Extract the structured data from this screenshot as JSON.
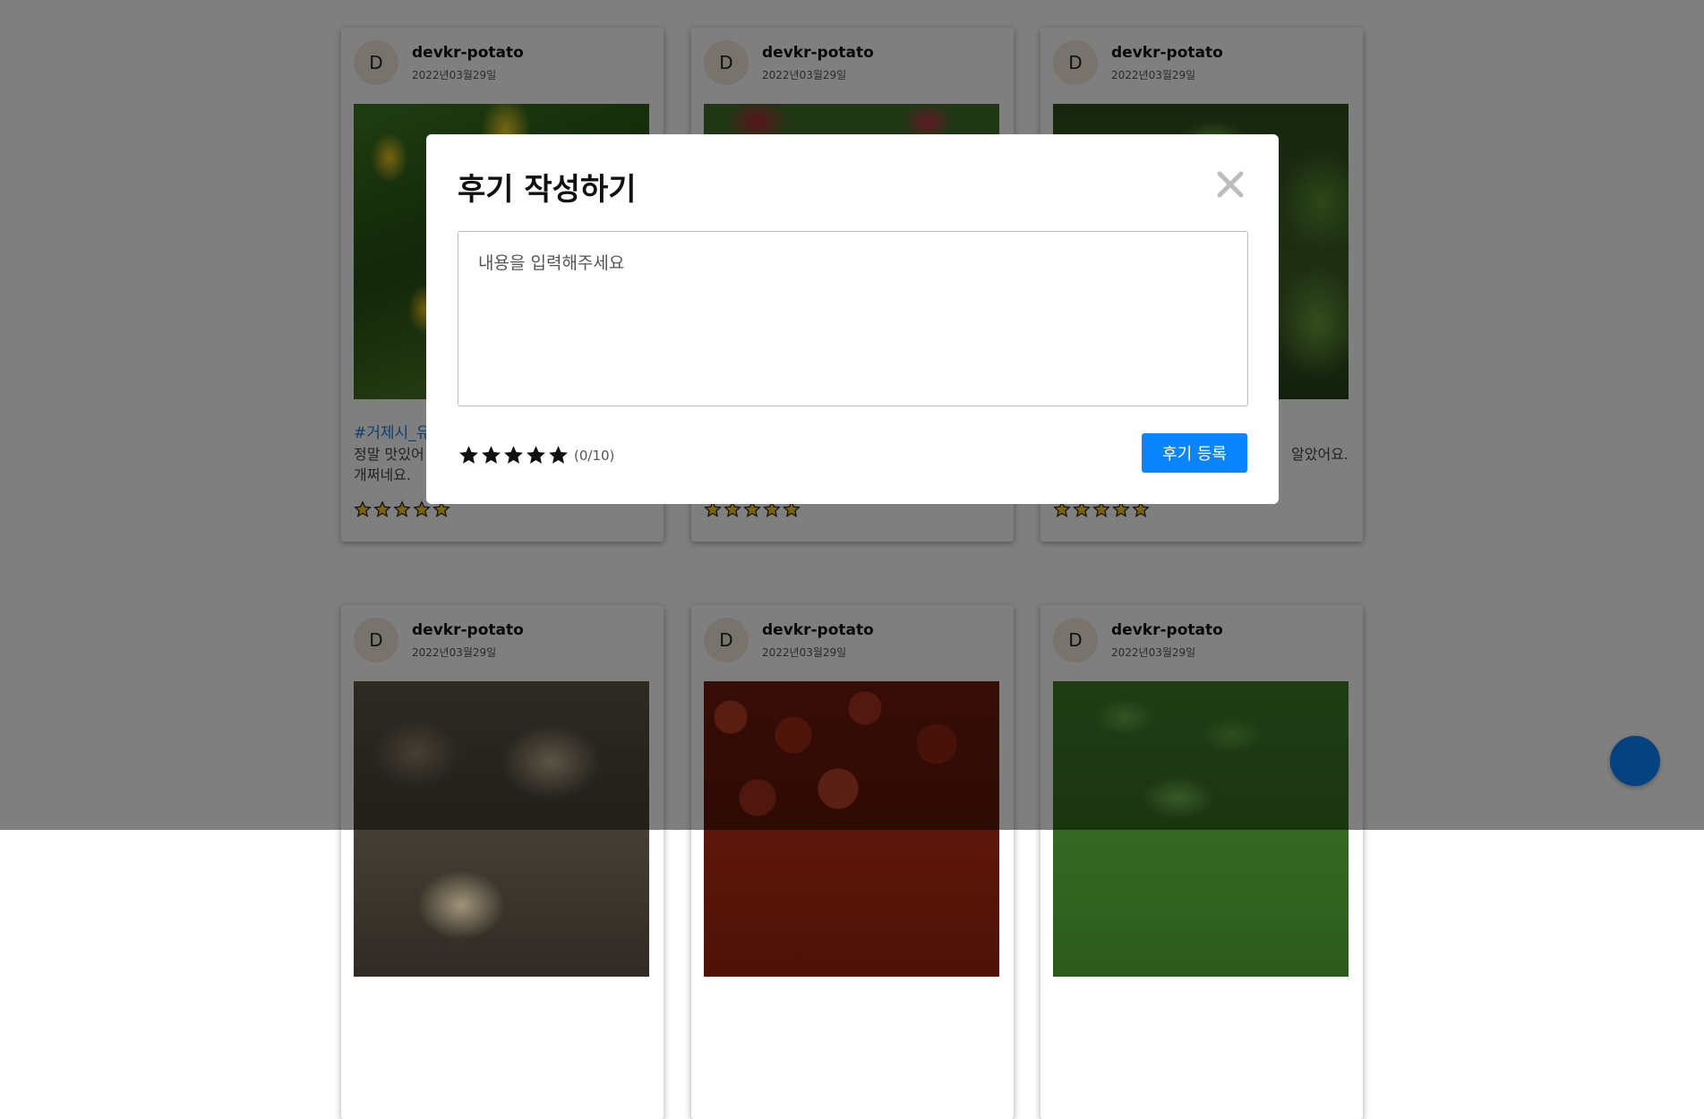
{
  "feed": {
    "posts": [
      {
        "avatar": "D",
        "username": "devkr-potato",
        "date": "2022년03월29일",
        "image": "lemon-tree-photo",
        "tag": "#거제시_유",
        "text": "정말 맛있어\n개쩌네요.",
        "stars": 5
      },
      {
        "avatar": "D",
        "username": "devkr-potato",
        "date": "2022년03월29일",
        "image": "apple-tree-photo",
        "tag": "",
        "text": "",
        "stars": 5
      },
      {
        "avatar": "D",
        "username": "devkr-potato",
        "date": "2022년03월29일",
        "image": "watermelon-field-photo",
        "tag": "",
        "text": "알았어요.",
        "stars": 5
      },
      {
        "avatar": "D",
        "username": "devkr-potato",
        "date": "2022년03월29일",
        "image": "oysters-photo",
        "tag": "",
        "text": "",
        "stars": 0
      },
      {
        "avatar": "D",
        "username": "devkr-potato",
        "date": "2022년03월29일",
        "image": "dried-jujubes-photo",
        "tag": "",
        "text": "",
        "stars": 0
      },
      {
        "avatar": "D",
        "username": "devkr-potato",
        "date": "2022년03월29일",
        "image": "green-herb-photo",
        "tag": "",
        "text": "",
        "stars": 0
      }
    ]
  },
  "modal": {
    "title": "후기 작성하기",
    "close_icon": "close-icon",
    "textarea_placeholder": "내용을 입력해주세요",
    "textarea_value": "",
    "rating_count": "(0/10)",
    "rating_star_icon": "star-icon",
    "submit_label": "후기 등록"
  },
  "colors": {
    "accent": "#0a84ff",
    "tag_link": "#1e7fd6",
    "star_fill": "#f3c623",
    "overlay": "rgba(0,0,0,0.5)"
  }
}
